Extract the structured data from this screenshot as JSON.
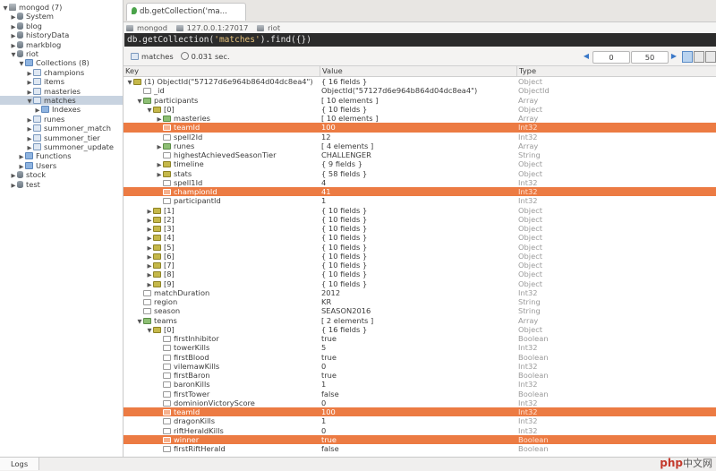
{
  "sidebar": {
    "items": [
      {
        "label": "mongod (7)",
        "indent": 0,
        "arrow": "▼",
        "icon": "server"
      },
      {
        "label": "System",
        "indent": 1,
        "arrow": "▶",
        "icon": "db"
      },
      {
        "label": "blog",
        "indent": 1,
        "arrow": "▶",
        "icon": "db"
      },
      {
        "label": "historyData",
        "indent": 1,
        "arrow": "▶",
        "icon": "db"
      },
      {
        "label": "markblog",
        "indent": 1,
        "arrow": "▶",
        "icon": "db"
      },
      {
        "label": "riot",
        "indent": 1,
        "arrow": "▼",
        "icon": "db"
      },
      {
        "label": "Collections (8)",
        "indent": 2,
        "arrow": "▼",
        "icon": "folder"
      },
      {
        "label": "champions",
        "indent": 3,
        "arrow": "▶",
        "icon": "table"
      },
      {
        "label": "items",
        "indent": 3,
        "arrow": "▶",
        "icon": "table"
      },
      {
        "label": "masteries",
        "indent": 3,
        "arrow": "▶",
        "icon": "table"
      },
      {
        "label": "matches",
        "indent": 3,
        "arrow": "▼",
        "icon": "table",
        "selected": true
      },
      {
        "label": "Indexes",
        "indent": 4,
        "arrow": "▶",
        "icon": "folder"
      },
      {
        "label": "runes",
        "indent": 3,
        "arrow": "▶",
        "icon": "table"
      },
      {
        "label": "summoner_match",
        "indent": 3,
        "arrow": "▶",
        "icon": "table"
      },
      {
        "label": "summoner_tier",
        "indent": 3,
        "arrow": "▶",
        "icon": "table"
      },
      {
        "label": "summoner_update",
        "indent": 3,
        "arrow": "▶",
        "icon": "table"
      },
      {
        "label": "Functions",
        "indent": 2,
        "arrow": "▶",
        "icon": "folder"
      },
      {
        "label": "Users",
        "indent": 2,
        "arrow": "▶",
        "icon": "folder"
      },
      {
        "label": "stock",
        "indent": 1,
        "arrow": "▶",
        "icon": "db"
      },
      {
        "label": "test",
        "indent": 1,
        "arrow": "▶",
        "icon": "db"
      }
    ]
  },
  "tab": {
    "label": "db.getCollection('ma..."
  },
  "connection": {
    "server": "mongod",
    "address": "127.0.0.1:27017",
    "database": "riot"
  },
  "query": {
    "prefix": "db.getCollection(",
    "arg": "'matches'",
    "suffix": ").find({})"
  },
  "result_bar": {
    "collection": "matches",
    "time": "0.031 sec.",
    "page_from": "0",
    "page_size": "50",
    "prev": "◀",
    "next": "▶"
  },
  "columns": {
    "key": "Key",
    "value": "Value",
    "type": "Type"
  },
  "rows": [
    {
      "d": 0,
      "t": "▼",
      "i": "object",
      "k": "(1) ObjectId(\"57127d6e964b864d04dc8ea4\")",
      "v": "{ 16 fields }",
      "y": "Object"
    },
    {
      "d": 1,
      "t": "",
      "i": "leaf",
      "k": "_id",
      "v": "ObjectId(\"57127d6e964b864d04dc8ea4\")",
      "y": "ObjectId"
    },
    {
      "d": 1,
      "t": "▼",
      "i": "array",
      "k": "participants",
      "v": "[ 10 elements ]",
      "y": "Array"
    },
    {
      "d": 2,
      "t": "▼",
      "i": "object",
      "k": "[0]",
      "v": "{ 10 fields }",
      "y": "Object"
    },
    {
      "d": 3,
      "t": "▶",
      "i": "array",
      "k": "masteries",
      "v": "[ 10 elements ]",
      "y": "Array"
    },
    {
      "d": 3,
      "t": "",
      "i": "leaf",
      "k": "teamId",
      "v": "100",
      "y": "Int32",
      "hl": true
    },
    {
      "d": 3,
      "t": "",
      "i": "leaf",
      "k": "spell2Id",
      "v": "12",
      "y": "Int32"
    },
    {
      "d": 3,
      "t": "▶",
      "i": "array",
      "k": "runes",
      "v": "[ 4 elements ]",
      "y": "Array"
    },
    {
      "d": 3,
      "t": "",
      "i": "leaf",
      "k": "highestAchievedSeasonTier",
      "v": "CHALLENGER",
      "y": "String"
    },
    {
      "d": 3,
      "t": "▶",
      "i": "object",
      "k": "timeline",
      "v": "{ 9 fields }",
      "y": "Object"
    },
    {
      "d": 3,
      "t": "▶",
      "i": "object",
      "k": "stats",
      "v": "{ 58 fields }",
      "y": "Object"
    },
    {
      "d": 3,
      "t": "",
      "i": "leaf",
      "k": "spell1Id",
      "v": "4",
      "y": "Int32"
    },
    {
      "d": 3,
      "t": "",
      "i": "leaf",
      "k": "championId",
      "v": "41",
      "y": "Int32",
      "hl": true
    },
    {
      "d": 3,
      "t": "",
      "i": "leaf",
      "k": "participantId",
      "v": "1",
      "y": "Int32"
    },
    {
      "d": 2,
      "t": "▶",
      "i": "object",
      "k": "[1]",
      "v": "{ 10 fields }",
      "y": "Object"
    },
    {
      "d": 2,
      "t": "▶",
      "i": "object",
      "k": "[2]",
      "v": "{ 10 fields }",
      "y": "Object"
    },
    {
      "d": 2,
      "t": "▶",
      "i": "object",
      "k": "[3]",
      "v": "{ 10 fields }",
      "y": "Object"
    },
    {
      "d": 2,
      "t": "▶",
      "i": "object",
      "k": "[4]",
      "v": "{ 10 fields }",
      "y": "Object"
    },
    {
      "d": 2,
      "t": "▶",
      "i": "object",
      "k": "[5]",
      "v": "{ 10 fields }",
      "y": "Object"
    },
    {
      "d": 2,
      "t": "▶",
      "i": "object",
      "k": "[6]",
      "v": "{ 10 fields }",
      "y": "Object"
    },
    {
      "d": 2,
      "t": "▶",
      "i": "object",
      "k": "[7]",
      "v": "{ 10 fields }",
      "y": "Object"
    },
    {
      "d": 2,
      "t": "▶",
      "i": "object",
      "k": "[8]",
      "v": "{ 10 fields }",
      "y": "Object"
    },
    {
      "d": 2,
      "t": "▶",
      "i": "object",
      "k": "[9]",
      "v": "{ 10 fields }",
      "y": "Object"
    },
    {
      "d": 1,
      "t": "",
      "i": "leaf",
      "k": "matchDuration",
      "v": "2012",
      "y": "Int32"
    },
    {
      "d": 1,
      "t": "",
      "i": "leaf",
      "k": "region",
      "v": "KR",
      "y": "String"
    },
    {
      "d": 1,
      "t": "",
      "i": "leaf",
      "k": "season",
      "v": "SEASON2016",
      "y": "String"
    },
    {
      "d": 1,
      "t": "▼",
      "i": "array",
      "k": "teams",
      "v": "[ 2 elements ]",
      "y": "Array"
    },
    {
      "d": 2,
      "t": "▼",
      "i": "object",
      "k": "[0]",
      "v": "{ 16 fields }",
      "y": "Object"
    },
    {
      "d": 3,
      "t": "",
      "i": "leaf",
      "k": "firstInhibitor",
      "v": "true",
      "y": "Boolean"
    },
    {
      "d": 3,
      "t": "",
      "i": "leaf",
      "k": "towerKills",
      "v": "5",
      "y": "Int32"
    },
    {
      "d": 3,
      "t": "",
      "i": "leaf",
      "k": "firstBlood",
      "v": "true",
      "y": "Boolean"
    },
    {
      "d": 3,
      "t": "",
      "i": "leaf",
      "k": "vilemawKills",
      "v": "0",
      "y": "Int32"
    },
    {
      "d": 3,
      "t": "",
      "i": "leaf",
      "k": "firstBaron",
      "v": "true",
      "y": "Boolean"
    },
    {
      "d": 3,
      "t": "",
      "i": "leaf",
      "k": "baronKills",
      "v": "1",
      "y": "Int32"
    },
    {
      "d": 3,
      "t": "",
      "i": "leaf",
      "k": "firstTower",
      "v": "false",
      "y": "Boolean"
    },
    {
      "d": 3,
      "t": "",
      "i": "leaf",
      "k": "dominionVictoryScore",
      "v": "0",
      "y": "Int32"
    },
    {
      "d": 3,
      "t": "",
      "i": "leaf",
      "k": "teamId",
      "v": "100",
      "y": "Int32",
      "hl": true
    },
    {
      "d": 3,
      "t": "",
      "i": "leaf",
      "k": "dragonKills",
      "v": "1",
      "y": "Int32"
    },
    {
      "d": 3,
      "t": "",
      "i": "leaf",
      "k": "riftHeraldKills",
      "v": "0",
      "y": "Int32"
    },
    {
      "d": 3,
      "t": "",
      "i": "leaf",
      "k": "winner",
      "v": "true",
      "y": "Boolean",
      "hl": true
    },
    {
      "d": 3,
      "t": "",
      "i": "leaf",
      "k": "firstRiftHerald",
      "v": "false",
      "y": "Boolean"
    }
  ],
  "bottom": {
    "logs": "Logs",
    "watermark": "php",
    "watermark_cn": "中文网"
  },
  "colors": {
    "highlight": "#ec7b43",
    "query_bg": "#2b2b2b",
    "selected_tree": "#c8d3e0"
  }
}
